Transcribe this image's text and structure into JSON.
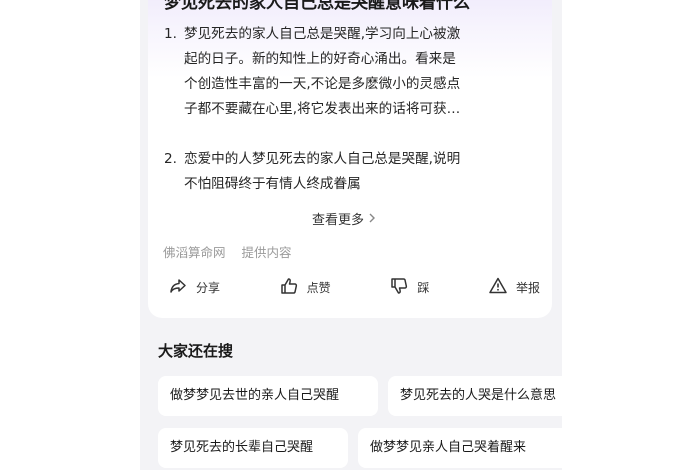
{
  "card": {
    "title": "梦见死去的家人自己总是哭醒意味着什么",
    "items": [
      {
        "num": "1.",
        "lines": [
          "梦见死去的家人自己总是哭醒,学习向上心被激",
          "起的日子。新的知性上的好奇心涌出。看来是",
          "个创造性丰富的一天,不论是多麽微小的灵感点",
          "子都不要藏在心里,将它发表出来的话将可获…"
        ]
      },
      {
        "num": "2.",
        "lines": [
          "恋爱中的人梦见死去的家人自己总是哭醒,说明",
          "不怕阻碍终于有情人终成眷属"
        ]
      }
    ],
    "more_label": "查看更多",
    "source": {
      "site": "佛滔算命网",
      "provided": "提供内容"
    },
    "actions": {
      "share": "分享",
      "like": "点赞",
      "dislike": "踩",
      "report": "举报"
    }
  },
  "related": {
    "title": "大家还在搜",
    "chips": [
      "做梦梦见去世的亲人自己哭醒",
      "梦见死去的人哭是什么意思",
      "梦见死去的长辈自己哭醒",
      "做梦梦见亲人自己哭着醒来"
    ]
  },
  "icons": {
    "share": "share-icon",
    "like": "thumbs-up-icon",
    "dislike": "thumbs-down-icon",
    "report": "warning-icon",
    "more": "chevron-right-icon"
  }
}
